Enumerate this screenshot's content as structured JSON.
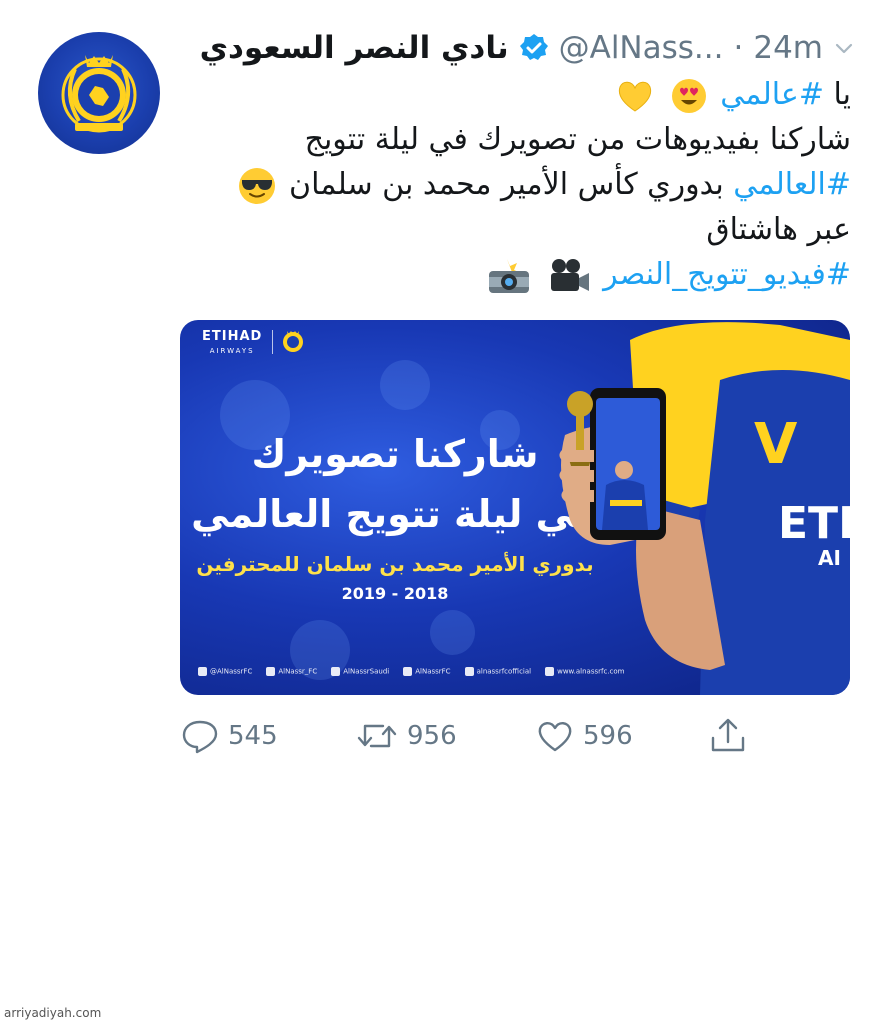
{
  "tweet": {
    "author_name": "نادي النصر السعودي",
    "handle": "@AlNass...",
    "separator": "·",
    "time": "24m",
    "lines": [
      {
        "plain": "يا ",
        "hashtag": "#عالمي"
      },
      {
        "plain": "شاركنا بفيديوهات من تصويرك في ليلة تتويج"
      },
      {
        "hashtag": "#العالمي",
        "plain": " بدوري كأس الأمير محمد بن سلمان"
      },
      {
        "plain": "عبر هاشتاق"
      },
      {
        "hashtag": "#فيديو_تتويج_النصر"
      }
    ],
    "emojis": [
      "heart-eyes-emoji",
      "yellow-heart-emoji",
      "sunglasses-emoji",
      "movie-camera-emoji",
      "camera-flash-emoji"
    ]
  },
  "media": {
    "sponsor": "ETIHAD",
    "sponsor_sub": "AIRWAYS",
    "line1": "شاركنا تصويرك",
    "line2": "في ليلة تتويج العالمي",
    "line3": "بدوري الأمير محمد بن سلمان للمحترفين",
    "season": "2019 - 2018",
    "footer": [
      "@AlNassrFC",
      "AlNassr_FC",
      "AlNassrSaudi",
      "AlNassrFC",
      "alnassrfcofficial",
      "www.alnassrfc.com"
    ],
    "shirt_letter": "V",
    "shirt_text": "ETI",
    "shirt_text2": "AI"
  },
  "actions": {
    "replies": "545",
    "retweets": "956",
    "likes": "596"
  },
  "watermark": "arriyadiyah.com",
  "colors": {
    "link": "#1da1f2",
    "meta": "#657786",
    "club_blue": "#1b3fae",
    "club_yellow": "#ffd21f"
  }
}
